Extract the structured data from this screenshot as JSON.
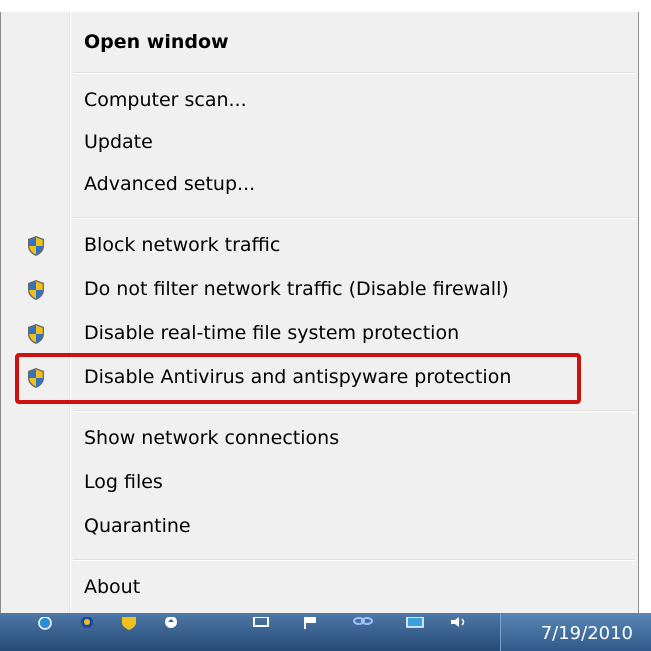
{
  "menu": {
    "items": [
      {
        "label": "Open window",
        "bold": true,
        "shield": false
      },
      {
        "label": "Computer scan...",
        "bold": false,
        "shield": false
      },
      {
        "label": "Update",
        "bold": false,
        "shield": false
      },
      {
        "label": "Advanced setup...",
        "bold": false,
        "shield": false
      },
      {
        "label": "Block network traffic",
        "bold": false,
        "shield": true
      },
      {
        "label": "Do not filter network traffic (Disable firewall)",
        "bold": false,
        "shield": true
      },
      {
        "label": "Disable real-time file system protection",
        "bold": false,
        "shield": true
      },
      {
        "label": "Disable Antivirus and antispyware protection",
        "bold": false,
        "shield": true
      },
      {
        "label": "Show network connections",
        "bold": false,
        "shield": false
      },
      {
        "label": "Log files",
        "bold": false,
        "shield": false
      },
      {
        "label": "Quarantine",
        "bold": false,
        "shield": false
      },
      {
        "label": "About",
        "bold": false,
        "shield": false
      }
    ],
    "highlighted_item": "Disable Antivirus and antispyware protection",
    "highlight_color": "#cc1111"
  },
  "taskbar": {
    "date": "7/19/2010",
    "icons": [
      "network-icon",
      "eset-icon",
      "shield-tray-icon",
      "update-icon",
      "monitor-icon",
      "flag-icon",
      "link-icon",
      "display-icon",
      "volume-icon"
    ]
  },
  "colors": {
    "menu_background": "#f0f0f0",
    "taskbar": "#3a6290",
    "highlight": "#cc1111"
  }
}
